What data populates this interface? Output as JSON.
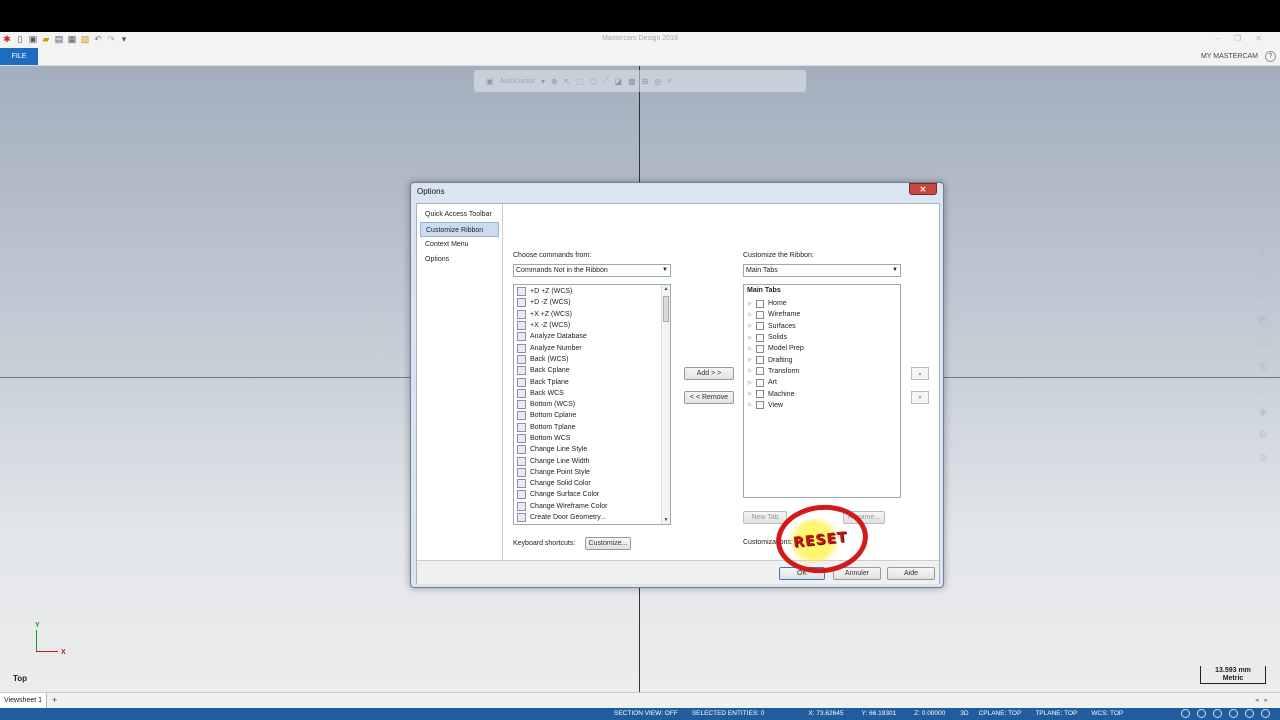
{
  "app": {
    "title": "Mastercam Design 2019",
    "menu_file": "FILE",
    "my_mastercam": "MY MASTERCAM"
  },
  "qat_icons": [
    "mastercam-logo-icon",
    "new-file-icon",
    "save-icon",
    "open-icon",
    "print-icon",
    "save-as-icon",
    "merge-icon",
    "undo-icon",
    "redo-icon",
    "qat-dropdown-icon"
  ],
  "float_toolbar": {
    "cursor_label": "AutoCursor"
  },
  "viewport": {
    "view_name": "Top",
    "gnomon_y": "Y",
    "gnomon_x": "X",
    "scale_value": "13.593 mm",
    "scale_unit": "Metric"
  },
  "sheets": {
    "tab": "Viewsheet 1",
    "add": "+"
  },
  "status": {
    "section_view": "SECTION VIEW: OFF",
    "selected": "SELECTED ENTITIES: 0",
    "x": "X:   73.62645",
    "y": "Y:   66.19301",
    "z": "Z:   0.00000",
    "mode": "3D",
    "cplane": "CPLANE: TOP",
    "tplane": "TPLANE: TOP",
    "wcs": "WCS: TOP"
  },
  "dialog": {
    "title": "Options",
    "close": "✕",
    "nav": [
      "Quick Access Toolbar",
      "Customize Ribbon",
      "Context Menu",
      "Options"
    ],
    "choose_label": "Choose commands from:",
    "choose_value": "Commands Not in the Ribbon",
    "commands": [
      "+D +Z (WCS)",
      "+D -Z (WCS)",
      "+X +Z (WCS)",
      "+X -Z (WCS)",
      "Analyze Database",
      "Analyze Number",
      "Back (WCS)",
      "Back Cplane",
      "Back Tplane",
      "Back WCS",
      "Bottom (WCS)",
      "Bottom Cplane",
      "Bottom Tplane",
      "Bottom WCS",
      "Change Line Style",
      "Change Line Width",
      "Change Point Style",
      "Change Solid Color",
      "Change Surface Color",
      "Change Wireframe Color",
      "Create Door Geometry..."
    ],
    "add_btn": "Add > >",
    "remove_btn": "< < Remove",
    "customize_label": "Customize the Ribbon:",
    "customize_value": "Main Tabs",
    "tree_header": "Main Tabs",
    "tabs": [
      "Home",
      "Wireframe",
      "Surfaces",
      "Solids",
      "Model Prep",
      "Drafting",
      "Transform",
      "Art",
      "Machine",
      "View"
    ],
    "new_tab": "New Tab",
    "rename": "Rename...",
    "keyboard_label": "Keyboard shortcuts:",
    "keyboard_btn": "Customize...",
    "customizations_label": "Customizations:",
    "ok": "OK",
    "cancel": "Annuler",
    "help": "Aide",
    "stamp": "RESET"
  }
}
